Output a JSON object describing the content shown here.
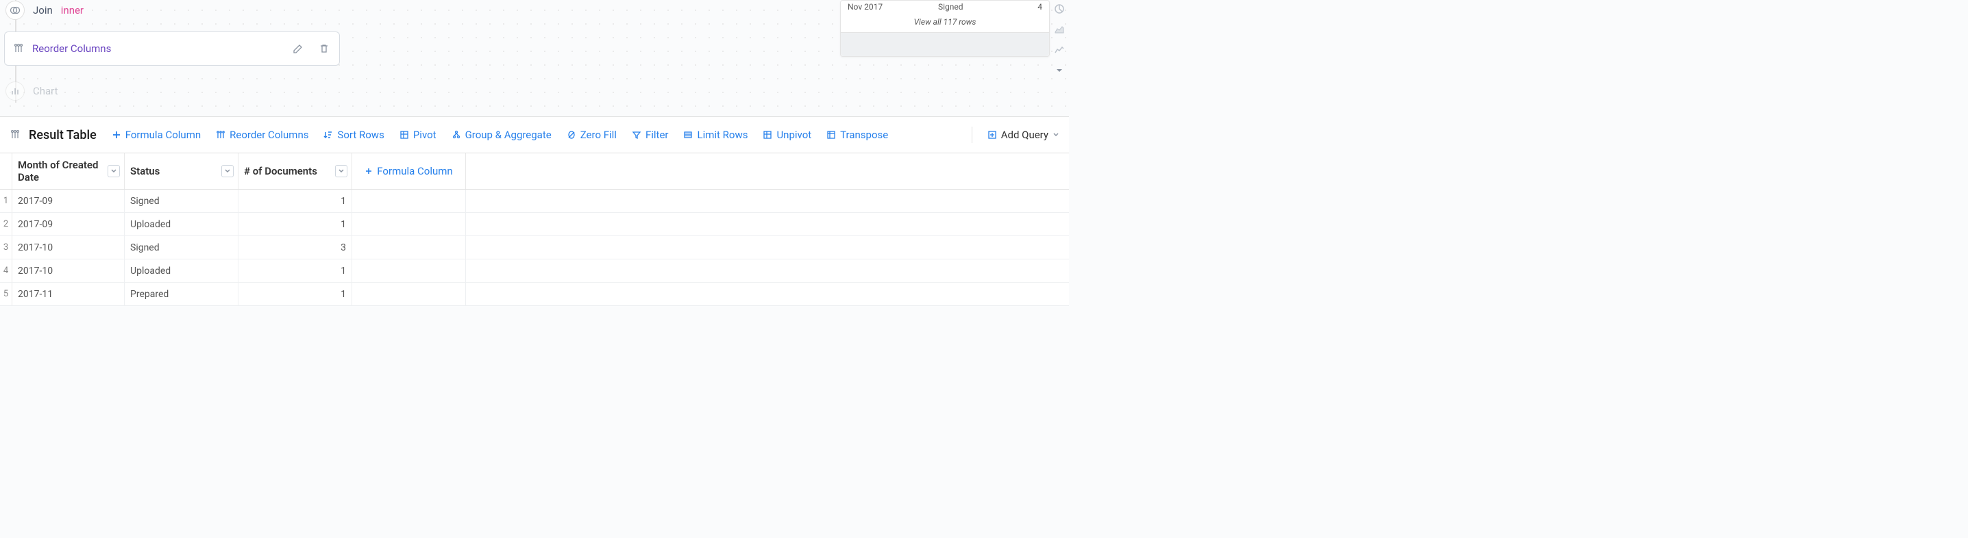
{
  "pipeline": {
    "join": {
      "label": "Join",
      "type": "inner"
    },
    "reorder": {
      "label": "Reorder Columns"
    },
    "chart": {
      "label": "Chart"
    }
  },
  "preview": {
    "row": {
      "month": "Nov 2017",
      "status": "Signed",
      "count": "4"
    },
    "view_all": "View all 117 rows"
  },
  "result": {
    "title": "Result Table",
    "actions": {
      "formula": "Formula Column",
      "reorder": "Reorder Columns",
      "sort": "Sort Rows",
      "pivot": "Pivot",
      "group": "Group & Aggregate",
      "zerofill": "Zero Fill",
      "filter": "Filter",
      "limit": "Limit Rows",
      "unpivot": "Unpivot",
      "transpose": "Transpose"
    },
    "add_query": "Add Query",
    "headers": {
      "month": "Month of Created Date",
      "status": "Status",
      "docs": "# of Documents",
      "formula": "Formula Column"
    },
    "rows": [
      {
        "n": "1",
        "month": "2017-09",
        "status": "Signed",
        "docs": "1"
      },
      {
        "n": "2",
        "month": "2017-09",
        "status": "Uploaded",
        "docs": "1"
      },
      {
        "n": "3",
        "month": "2017-10",
        "status": "Signed",
        "docs": "3"
      },
      {
        "n": "4",
        "month": "2017-10",
        "status": "Uploaded",
        "docs": "1"
      },
      {
        "n": "5",
        "month": "2017-11",
        "status": "Prepared",
        "docs": "1"
      }
    ]
  }
}
